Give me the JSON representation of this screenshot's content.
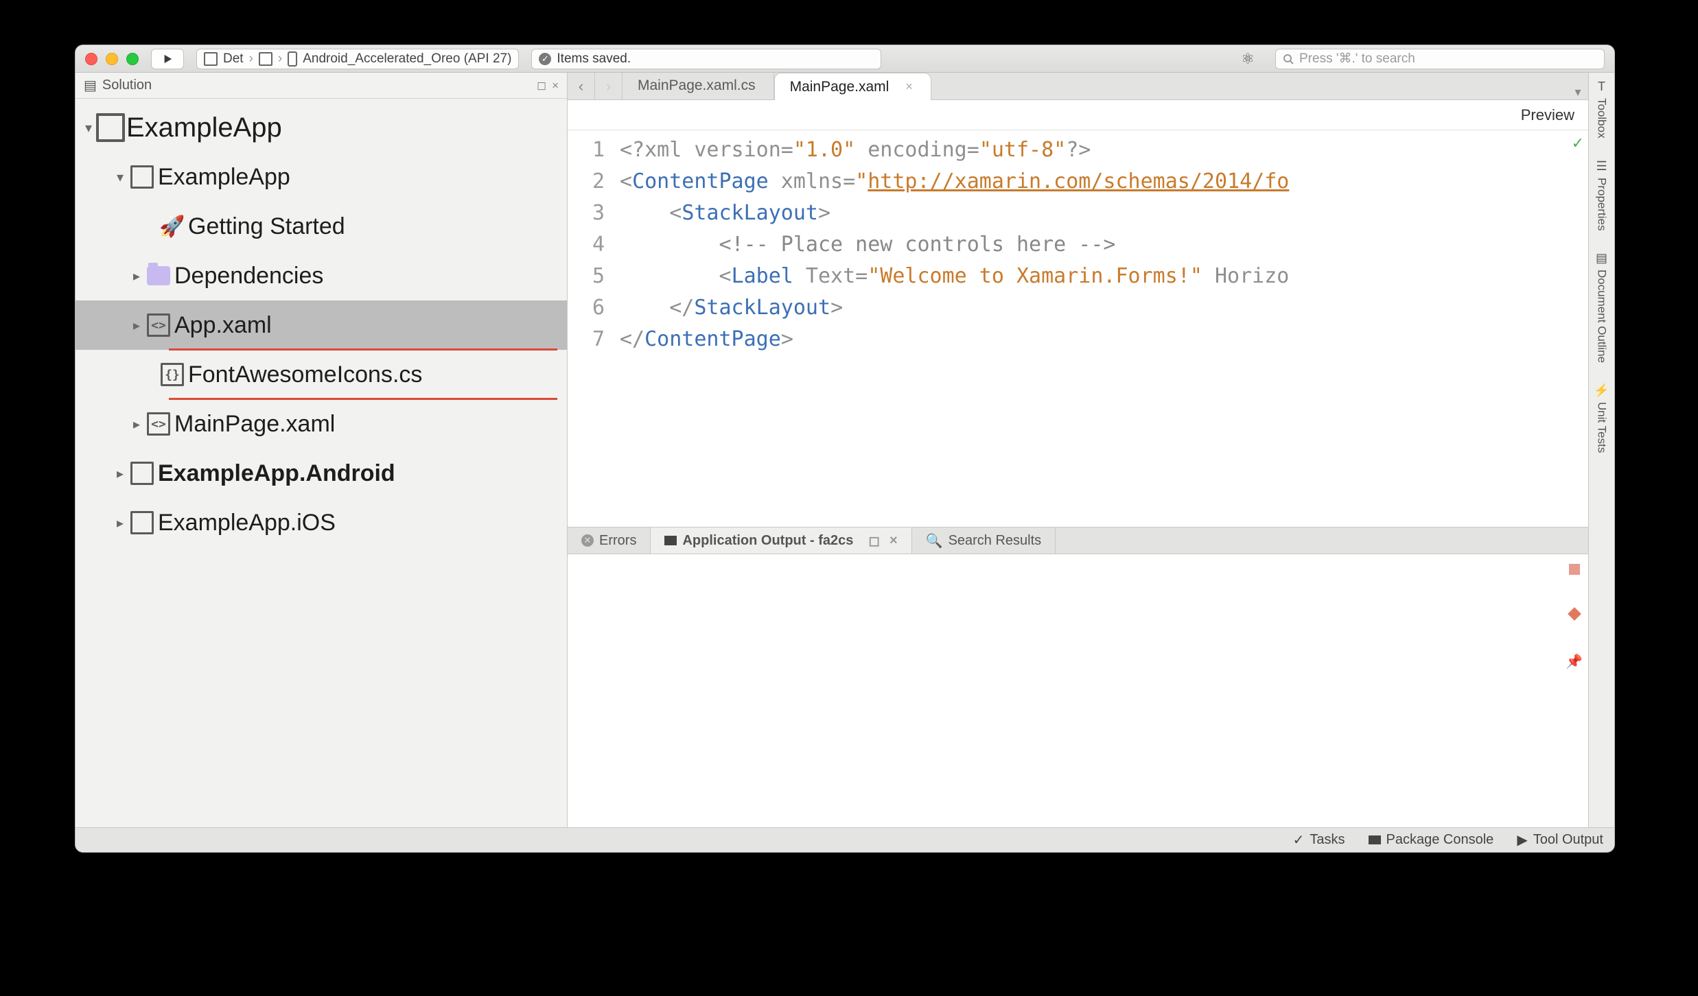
{
  "titlebar": {
    "config_project": "Det",
    "config_target": "Android_Accelerated_Oreo (API 27)",
    "status": "Items saved.",
    "search_placeholder": "Press '⌘.' to search"
  },
  "solution": {
    "header": "Solution",
    "root": "ExampleApp",
    "items": [
      {
        "label": "ExampleApp",
        "kind": "project",
        "bold": false
      },
      {
        "label": "Getting Started",
        "kind": "rocket"
      },
      {
        "label": "Dependencies",
        "kind": "folder"
      },
      {
        "label": "App.xaml",
        "kind": "xaml",
        "selected": true,
        "underline": true
      },
      {
        "label": "FontAwesomeIcons.cs",
        "kind": "cs",
        "underline": true
      },
      {
        "label": "MainPage.xaml",
        "kind": "xaml"
      },
      {
        "label": "ExampleApp.Android",
        "kind": "project",
        "bold": true
      },
      {
        "label": "ExampleApp.iOS",
        "kind": "project"
      }
    ]
  },
  "tabs": {
    "inactive": "MainPage.xaml.cs",
    "active": "MainPage.xaml"
  },
  "editor": {
    "preview_label": "Preview",
    "lines": [
      "1",
      "2",
      "3",
      "4",
      "5",
      "6",
      "7"
    ]
  },
  "code": {
    "l1_a": "<?",
    "l1_b": "xml",
    "l1_c": " version=",
    "l1_d": "\"1.0\"",
    "l1_e": " encoding=",
    "l1_f": "\"utf-8\"",
    "l1_g": "?>",
    "l2_a": "<",
    "l2_b": "ContentPage",
    "l2_c": " xmlns",
    "l2_d": "=",
    "l2_e": "\"",
    "l2_f": "http://xamarin.com/schemas/2014/fo",
    "l3_a": "    <",
    "l3_b": "StackLayout",
    "l3_c": ">",
    "l4_a": "        ",
    "l4_b": "<!-- Place new controls here -->",
    "l5_a": "        <",
    "l5_b": "Label",
    "l5_c": " Text=",
    "l5_d": "\"Welcome to Xamarin.Forms!\"",
    "l5_e": " Horizo",
    "l6_a": "    </",
    "l6_b": "StackLayout",
    "l6_c": ">",
    "l7_a": "</",
    "l7_b": "ContentPage",
    "l7_c": ">"
  },
  "bottom_tabs": {
    "errors": "Errors",
    "output": "Application Output - fa2cs",
    "search": "Search Results"
  },
  "rightrail": {
    "toolbox": "Toolbox",
    "properties": "Properties",
    "docoutline": "Document Outline",
    "unittests": "Unit Tests"
  },
  "statusbar": {
    "tasks": "Tasks",
    "pkg": "Package Console",
    "tool": "Tool Output"
  }
}
